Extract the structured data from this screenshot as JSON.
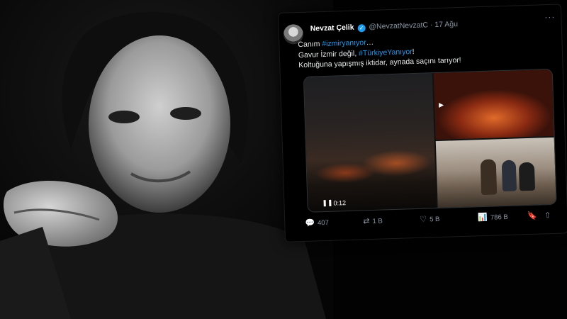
{
  "tweet": {
    "author_name": "Nevzat Çelik",
    "verified_icon": "✓",
    "handle": "@NevzatNevzatC",
    "separator": "·",
    "date": "17 Ağu",
    "more_icon": "···",
    "text": {
      "line1_prefix": "Canım ",
      "line1_tag": "#izmiryanıyor",
      "line1_suffix": "…",
      "line2_prefix": "Gavur İzmir değil, ",
      "line2_tag": "#TürkiyeYanıyor",
      "line2_suffix": "!",
      "line3": "Koltuğuna yapışmış iktidar, aynada saçını tarıyor!"
    },
    "media": {
      "video_play_icon": "❚❚",
      "video_time": "0:12",
      "second_play_icon": "▶"
    },
    "actions": {
      "reply_icon": "💬",
      "reply_count": "407",
      "retweet_icon": "⇄",
      "retweet_count": "1 B",
      "like_icon": "♡",
      "like_count": "5 B",
      "views_icon": "📊",
      "views_count": "786 B",
      "bookmark_icon": "🔖",
      "share_icon": "⇧"
    }
  },
  "colors": {
    "link": "#1d9bf0",
    "muted": "#8b98a5",
    "text": "#e7e9ea"
  }
}
